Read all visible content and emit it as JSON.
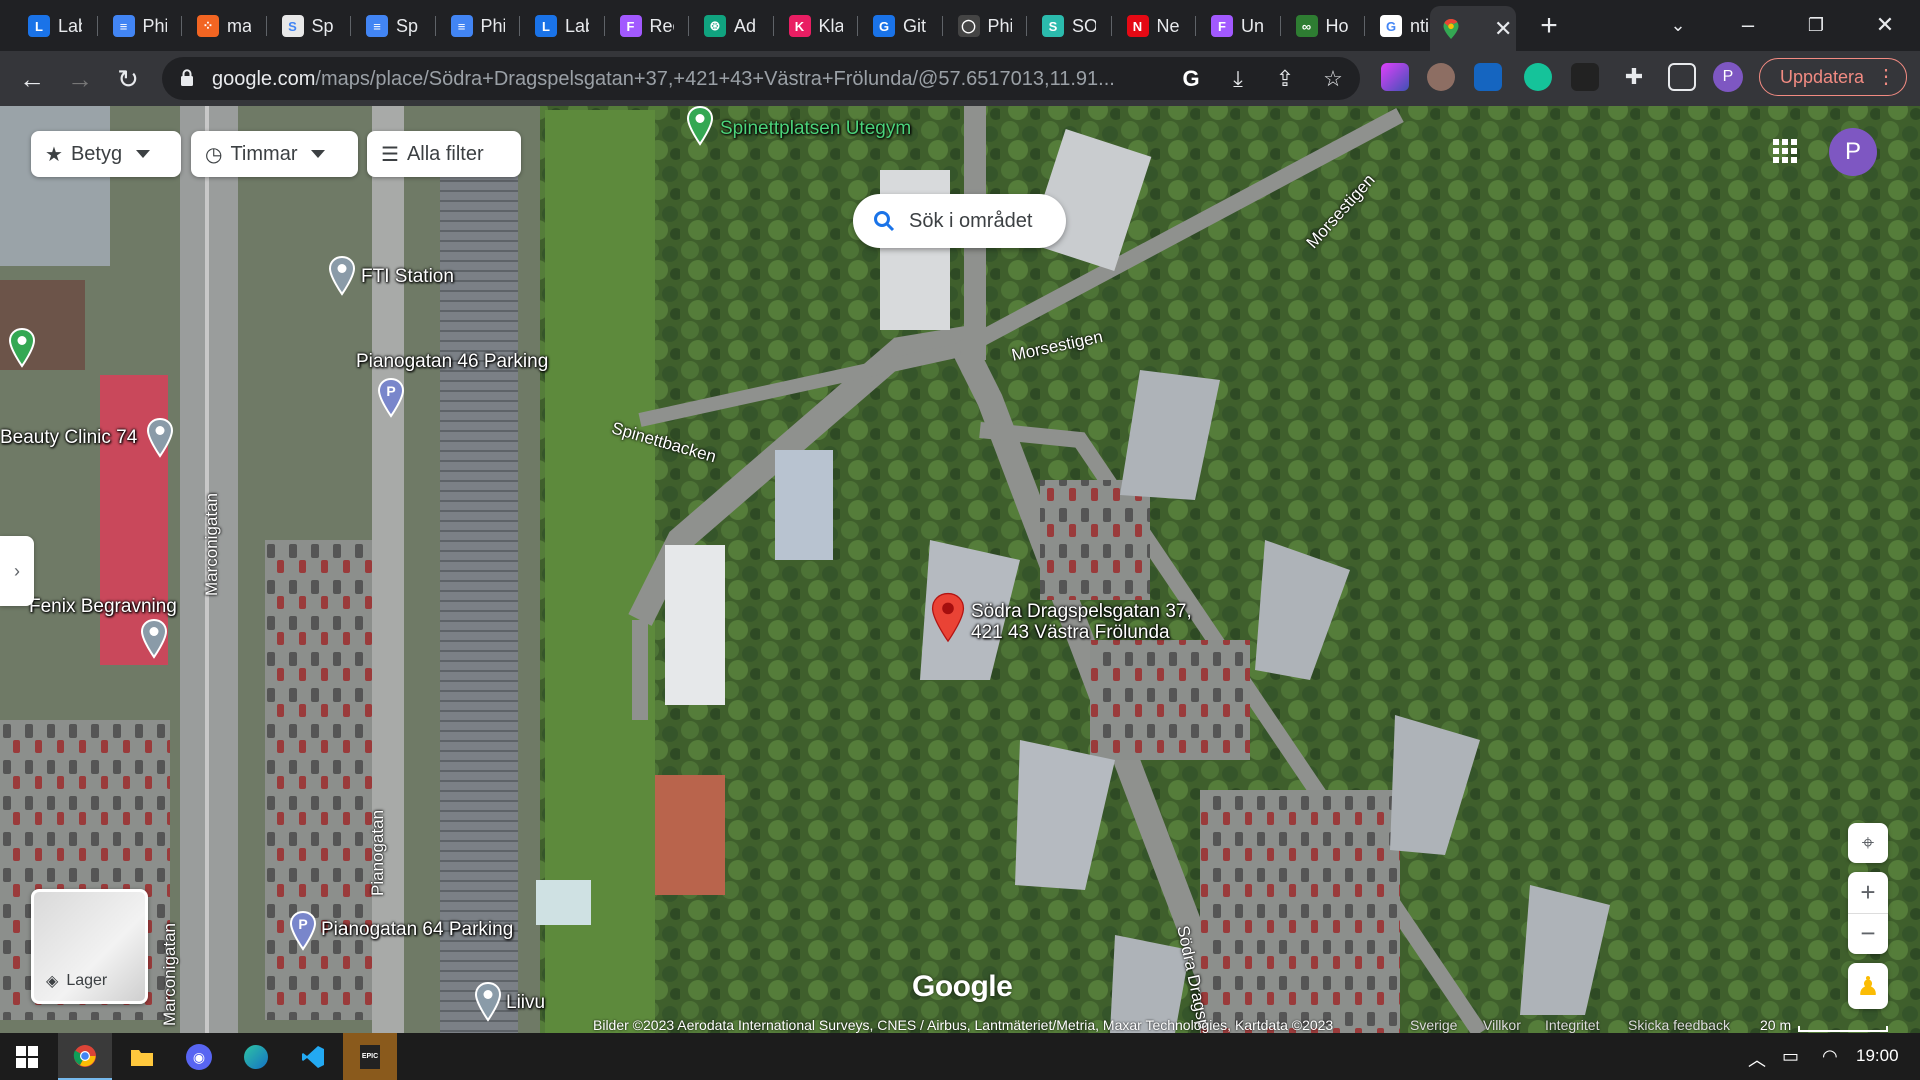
{
  "browser": {
    "tabs": [
      {
        "title": "Lab",
        "color": "#1a73e8",
        "glyph": "L"
      },
      {
        "title": "Phi",
        "color": "#4285f4",
        "glyph": "≡"
      },
      {
        "title": "ma",
        "color": "#f26522",
        "glyph": "⁘"
      },
      {
        "title": "Sp",
        "color": "#e8e8e8",
        "glyph": "S"
      },
      {
        "title": "Sp",
        "color": "#4285f4",
        "glyph": "≡"
      },
      {
        "title": "Phi",
        "color": "#4285f4",
        "glyph": "≡"
      },
      {
        "title": "Lab",
        "color": "#1a73e8",
        "glyph": "L"
      },
      {
        "title": "Rec",
        "color": "#a259ff",
        "glyph": "F"
      },
      {
        "title": "Ad",
        "color": "#10a37f",
        "glyph": "⊛"
      },
      {
        "title": "Kla",
        "color": "#e91e63",
        "glyph": "K"
      },
      {
        "title": "Git",
        "color": "#1a73e8",
        "glyph": "G"
      },
      {
        "title": "Phi",
        "color": "#444",
        "glyph": "◯"
      },
      {
        "title": "SO",
        "color": "#2bbbad",
        "glyph": "S"
      },
      {
        "title": "Ne",
        "color": "#e50914",
        "glyph": "N"
      },
      {
        "title": "Un",
        "color": "#a259ff",
        "glyph": "F"
      },
      {
        "title": "Ho",
        "color": "#2e7d32",
        "glyph": "∞"
      },
      {
        "title": "nti",
        "color": "#ffffff",
        "glyph": "G"
      }
    ],
    "active_tab_icon": "google-maps-icon",
    "url_host": "google.com",
    "url_path": "/maps/place/Södra+Dragspelsgatan+37,+421+43+Västra+Frölunda/@57.6517013,11.91...",
    "update_label": "Uppdatera",
    "profile_initial": "P"
  },
  "map": {
    "filters": {
      "rating": "Betyg",
      "hours": "Timmar",
      "all": "Alla filter"
    },
    "search_area": "Sök i området",
    "avatar_initial": "P",
    "places": {
      "spinett": "Spinettplatsen Utegym",
      "fti": "FTI Station",
      "piano46": "Pianogatan 46 Parking",
      "beauty": "Beauty Clinic 74",
      "fenix": "Fenix Begravning",
      "piano64": "Pianogatan 64 Parking",
      "liivu": "Liivu"
    },
    "selected_address_line1": "Södra Dragspelsgatan 37,",
    "selected_address_line2": "421 43 Västra Frölunda",
    "roads": {
      "morsestigen1": "Morsestigen",
      "morsestigen2": "Morsestigen",
      "spinettbacken": "Spinettbacken",
      "marconigatan1": "Marconigatan",
      "marconigatan2": "Marconigatan",
      "pianogatan": "Pianogatan",
      "sodra": "Södra Dragsp"
    },
    "layers_label": "Lager",
    "logo": "Google",
    "attribution": "Bilder ©2023 Aerodata International Surveys, CNES / Airbus, Lantmäteriet/Metria, Maxar Technologies, Kartdata ©2023",
    "footer_links": {
      "country": "Sverige",
      "terms": "Villkor",
      "privacy": "Integritet",
      "feedback": "Skicka feedback"
    },
    "scale": "20 m"
  },
  "taskbar": {
    "clock": "19:00",
    "apps": [
      "windows-start",
      "chrome",
      "file-explorer",
      "discord",
      "edge",
      "vscode",
      "epic-games"
    ]
  }
}
